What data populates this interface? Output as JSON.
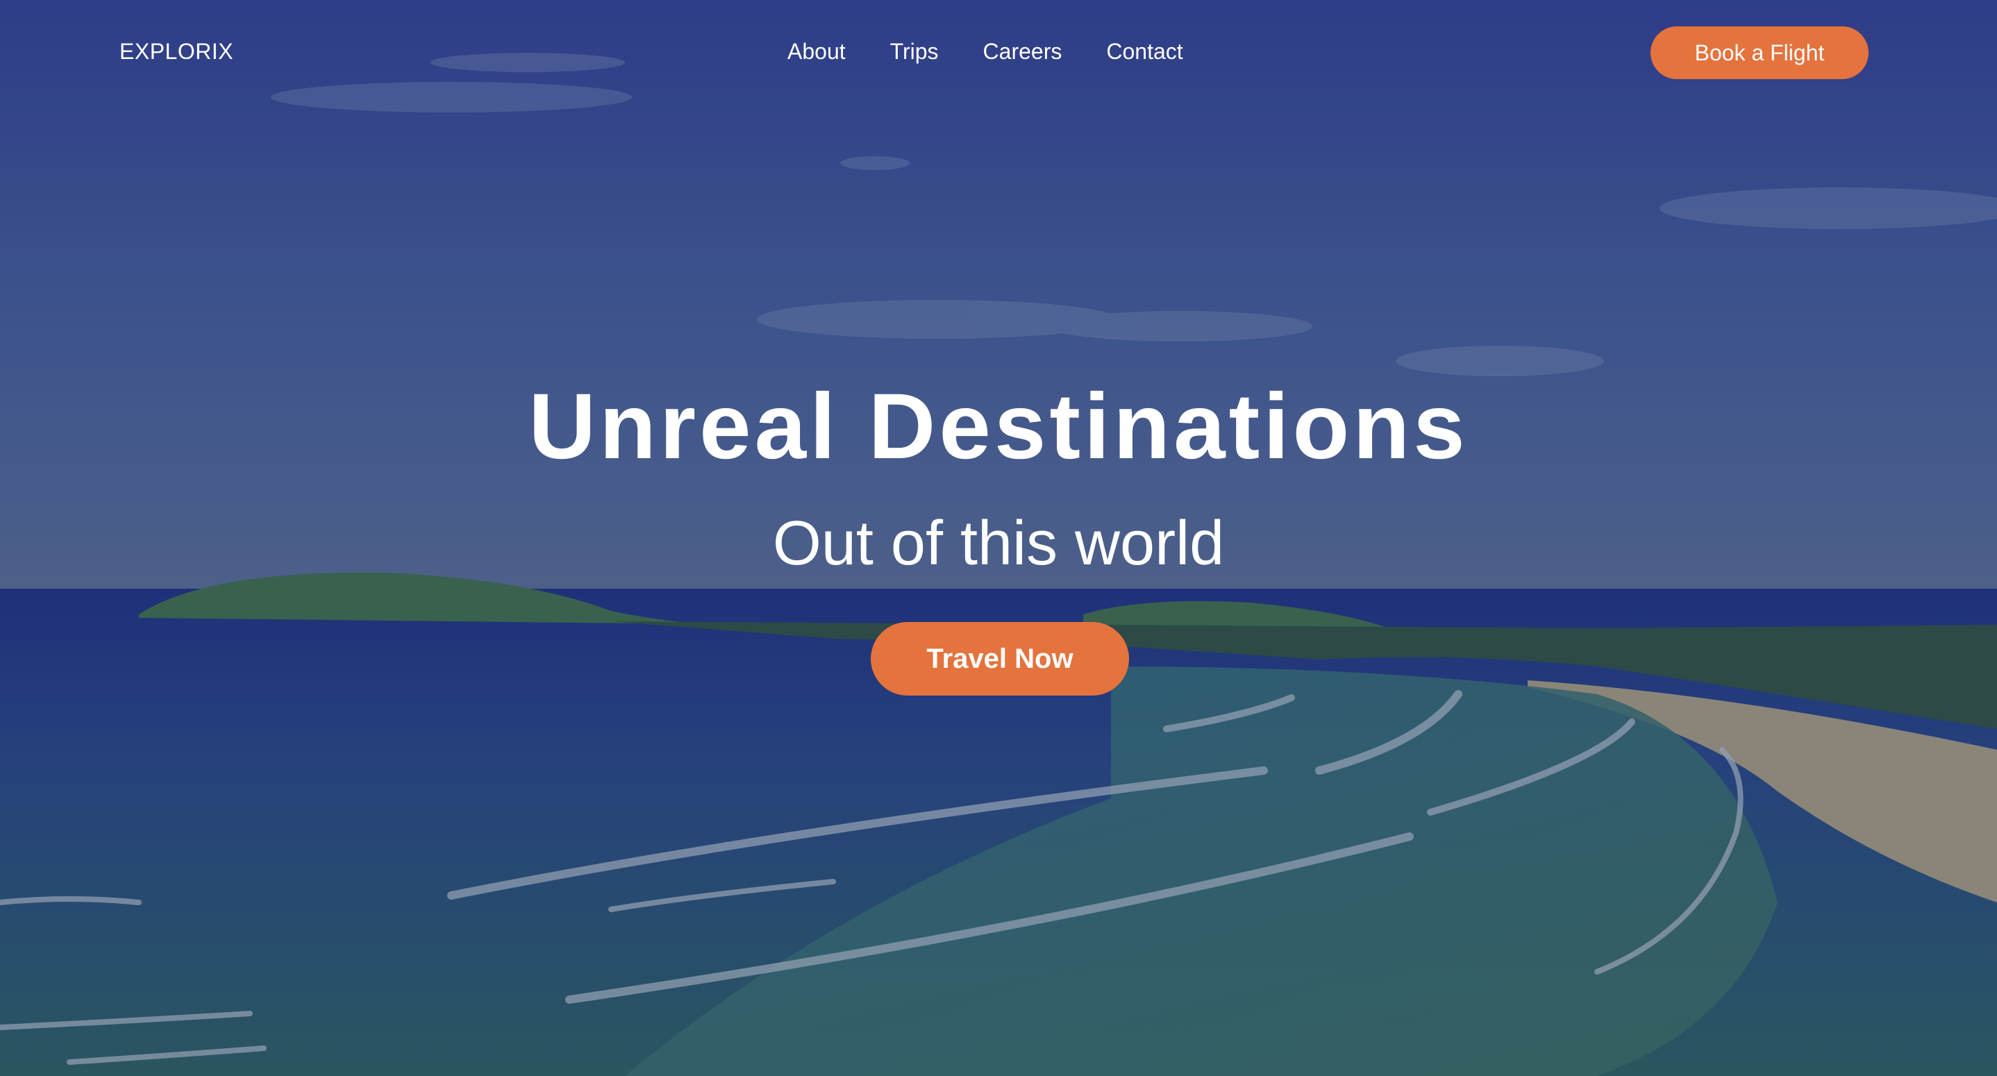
{
  "header": {
    "logo": "EXPLORIX",
    "nav": [
      {
        "label": "About"
      },
      {
        "label": "Trips"
      },
      {
        "label": "Careers"
      },
      {
        "label": "Contact"
      }
    ],
    "cta_label": "Book a Flight"
  },
  "hero": {
    "title": "Unreal Destinations",
    "subtitle": "Out of this world",
    "cta_label": "Travel Now"
  },
  "colors": {
    "accent": "#e4733d",
    "overlay": "#2d3d78"
  }
}
